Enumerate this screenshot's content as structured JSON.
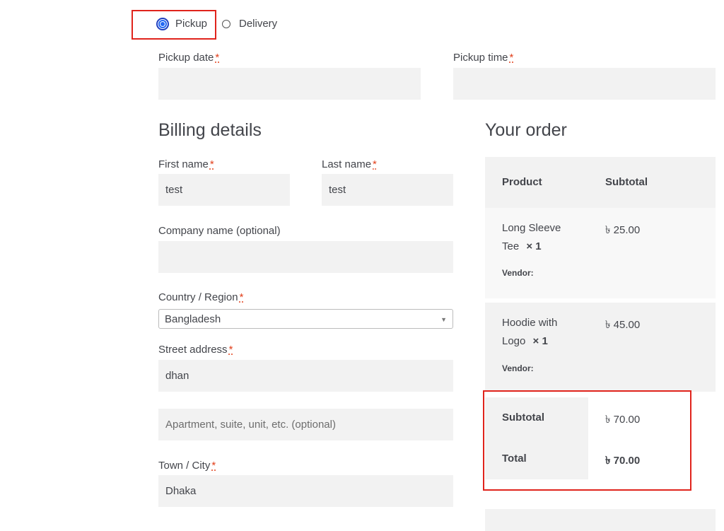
{
  "shipping_method": {
    "pickup_label": "Pickup",
    "delivery_label": "Delivery"
  },
  "pickup": {
    "date_label": "Pickup date",
    "time_label": "Pickup time",
    "required_mark": "*"
  },
  "billing": {
    "heading": "Billing details",
    "first_name_label": "First name",
    "first_name_value": "test",
    "last_name_label": "Last name",
    "last_name_value": "test",
    "company_label": "Company name (optional)",
    "country_label": "Country / Region",
    "country_value": "Bangladesh",
    "street_label": "Street address",
    "street_value": "dhan",
    "apartment_placeholder": "Apartment, suite, unit, etc. (optional)",
    "city_label": "Town / City",
    "city_value": "Dhaka"
  },
  "order": {
    "heading": "Your order",
    "col_product": "Product",
    "col_subtotal": "Subtotal",
    "items": [
      {
        "name_line1": "Long Sleeve",
        "name_line2": "Tee",
        "qty": "× 1",
        "vendor": "Vendor:",
        "price": "৳ 25.00"
      },
      {
        "name_line1": "Hoodie with",
        "name_line2": "Logo",
        "qty": "× 1",
        "vendor": "Vendor:",
        "price": "৳ 45.00"
      }
    ],
    "subtotal_label": "Subtotal",
    "subtotal_value": "৳ 70.00",
    "total_label": "Total",
    "total_value": "৳ 70.00"
  },
  "colors": {
    "highlight": "#e0241c",
    "field_bg": "#f2f2f2",
    "table_bg": "#f8f8f8",
    "required": "#e2401c",
    "radio_accent": "#2468f2"
  }
}
